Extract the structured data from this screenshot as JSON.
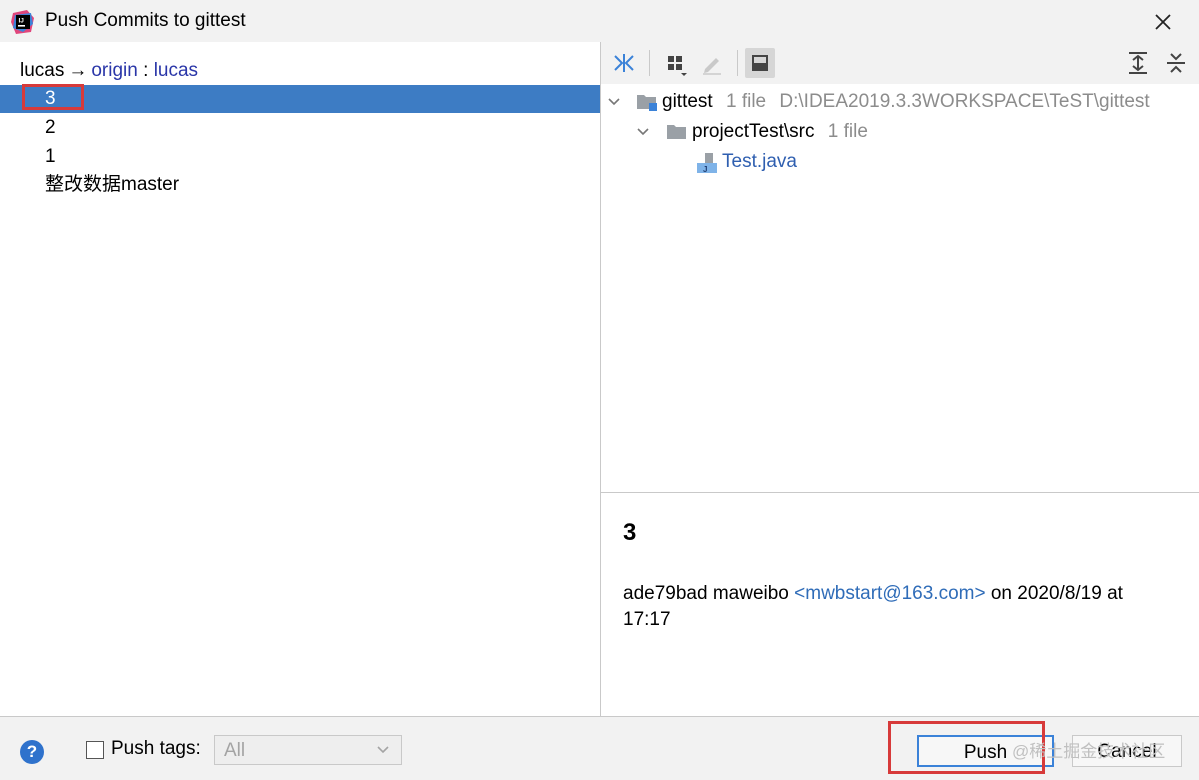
{
  "window": {
    "title": "Push Commits to gittest"
  },
  "branch": {
    "local": "lucas",
    "arrow": "→",
    "remote": "origin",
    "sep": ":",
    "remote_branch": "lucas"
  },
  "commits": [
    {
      "label": "3",
      "selected": true
    },
    {
      "label": "2",
      "selected": false
    },
    {
      "label": "1",
      "selected": false
    },
    {
      "label": "整改数据master",
      "selected": false
    }
  ],
  "toolbar": {
    "icons": [
      "collapse-icon",
      "group-by-icon",
      "edit-icon",
      "preview-icon",
      "expand-all-icon",
      "collapse-all-icon"
    ]
  },
  "tree": {
    "root": {
      "name": "gittest",
      "count": "1 file",
      "path": "D:\\IDEA2019.3.3WORKSPACE\\TeST\\gittest"
    },
    "folder": {
      "name": "projectTest\\src",
      "count": "1 file"
    },
    "file": {
      "name": "Test.java"
    }
  },
  "details": {
    "title": "3",
    "hash": "ade79bad",
    "author": "maweibo",
    "email": "<mwbstart@163.com>",
    "on": "on",
    "date": "2020/8/19 at 17:17"
  },
  "footer": {
    "help": "?",
    "push_tags_label": "Push tags:",
    "tags_select": "All",
    "push_button": "Push",
    "cancel_button": "Cancel",
    "watermark": "@稀土掘金技术社区"
  },
  "colors": {
    "selection": "#3d7cc4",
    "link": "#2a36a8",
    "highlight_box": "#d73a3a",
    "accent": "#3b82d8"
  }
}
